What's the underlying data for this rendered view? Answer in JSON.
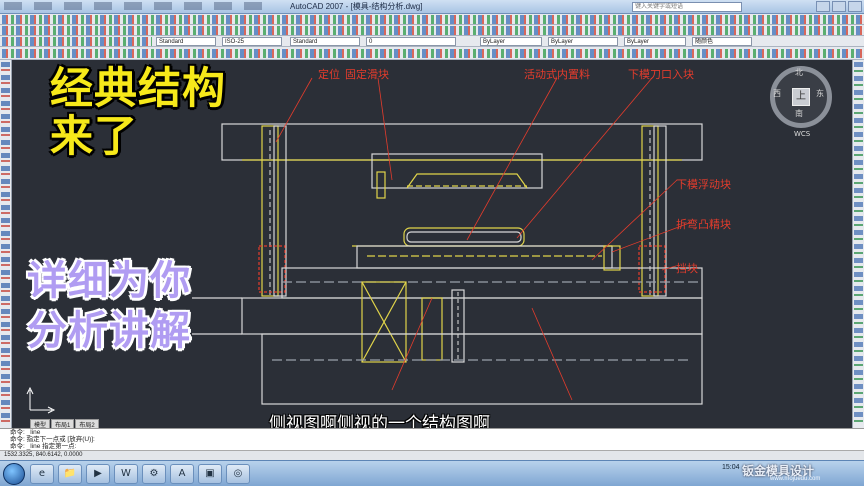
{
  "window": {
    "title": "AutoCAD 2007 - [模具-结构分析.dwg]",
    "search_placeholder": "键入关键字或短语"
  },
  "toolbar": {
    "standard_label": "Standard",
    "iso_label": "ISO-25",
    "layer_value": "0",
    "color_value": "ByLayer",
    "linetype_value": "ByLayer",
    "lineweight_value": "ByLayer",
    "plot_value": "随颜色"
  },
  "overlay": {
    "line1": "经典结构",
    "line2": "来了",
    "line3": "详细为你",
    "line4": "分析讲解"
  },
  "drawing": {
    "callouts": {
      "locate": "定位",
      "fixed_block": "固定滑块",
      "movable_insert": "活动式内置料",
      "lower_die_blade": "下模刀口入块",
      "lower_floating_block": "下模浮动块",
      "bending_block": "折弯凸精块",
      "stop_block": "挡块"
    }
  },
  "subtitle": "侧视图啊侧视的一个结构图啊",
  "viewcube": {
    "top": "上",
    "north": "北",
    "south": "南",
    "east": "东",
    "west": "西",
    "wcs": "WCS"
  },
  "layout_tabs": [
    "模型",
    "布局1",
    "布局2"
  ],
  "command_lines": [
    "命令: _line",
    "命令: 指定下一点或 [放弃(U)]:",
    "命令: _line 指定第一点:"
  ],
  "status": {
    "coords": "1532.3325, 840.6142, 0.0000"
  },
  "taskbar": {
    "apps": [
      "e",
      "📁",
      "▶",
      "W",
      "⚙",
      "A",
      "▣",
      "◎"
    ],
    "tray_time": "15:04"
  },
  "watermark": {
    "brand": "钣金模具设计",
    "url": "www.mojuedu.com"
  }
}
